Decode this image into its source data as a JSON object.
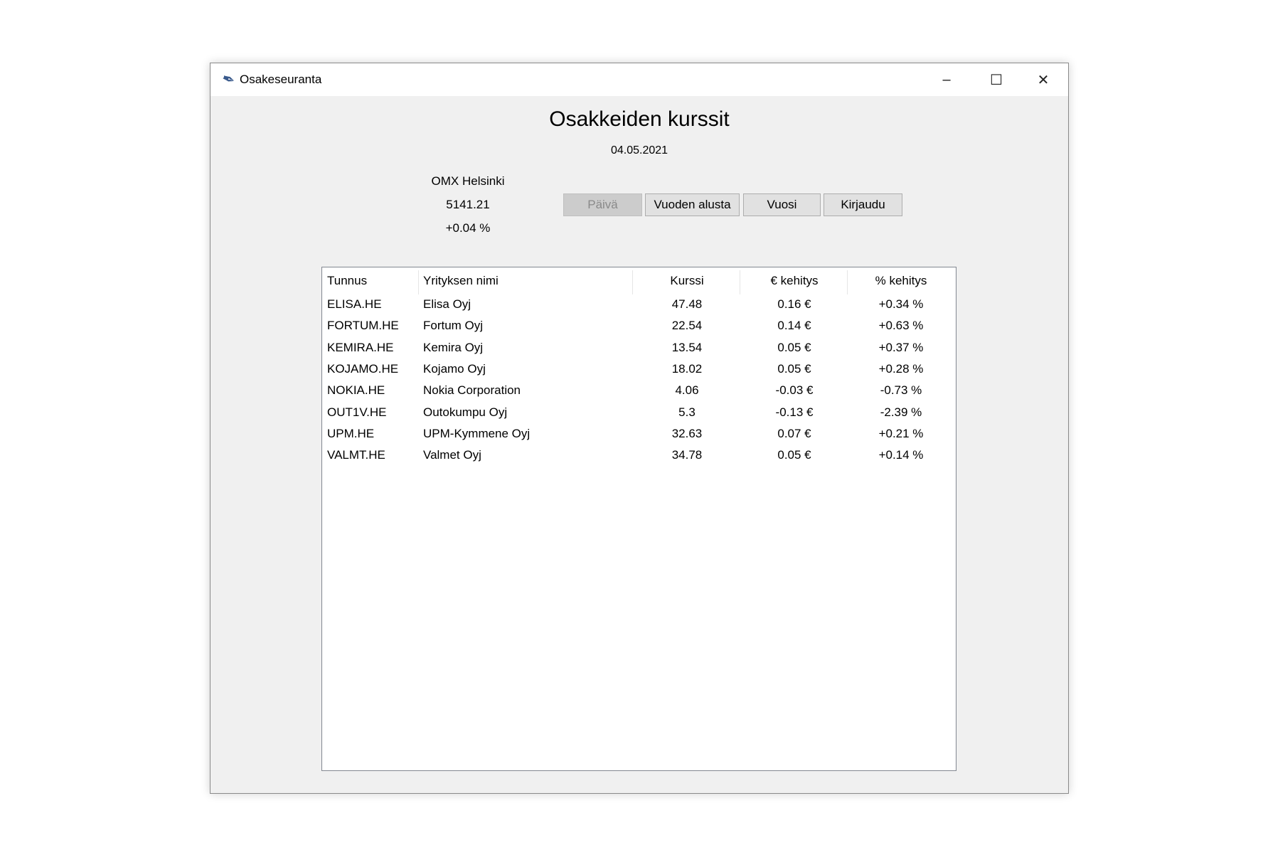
{
  "window": {
    "title": "Osakeseuranta",
    "minimize": "–",
    "maximize": "☐",
    "close": "✕"
  },
  "heading": "Osakkeiden kurssit",
  "date": "04.05.2021",
  "index": {
    "name": "OMX Helsinki",
    "value": "5141.21",
    "change": "+0.04 %"
  },
  "buttons": {
    "day": "Päivä",
    "ytd": "Vuoden alusta",
    "year": "Vuosi",
    "login": "Kirjaudu"
  },
  "table": {
    "columns": [
      "Tunnus",
      "Yrityksen nimi",
      "Kurssi",
      "€ kehitys",
      "% kehitys"
    ],
    "rows": [
      [
        "ELISA.HE",
        "Elisa Oyj",
        "47.48",
        "0.16 €",
        "+0.34 %"
      ],
      [
        "FORTUM.HE",
        "Fortum Oyj",
        "22.54",
        "0.14 €",
        "+0.63 %"
      ],
      [
        "KEMIRA.HE",
        "Kemira Oyj",
        "13.54",
        "0.05 €",
        "+0.37 %"
      ],
      [
        "KOJAMO.HE",
        "Kojamo Oyj",
        "18.02",
        "0.05 €",
        "+0.28 %"
      ],
      [
        "NOKIA.HE",
        "Nokia Corporation",
        "4.06",
        "-0.03 €",
        "-0.73 %"
      ],
      [
        "OUT1V.HE",
        "Outokumpu Oyj",
        "5.3",
        "-0.13 €",
        "-2.39 %"
      ],
      [
        "UPM.HE",
        "UPM-Kymmene Oyj",
        "32.63",
        "0.07 €",
        "+0.21 %"
      ],
      [
        "VALMT.HE",
        "Valmet Oyj",
        "34.78",
        "0.05 €",
        "+0.14 %"
      ]
    ]
  }
}
